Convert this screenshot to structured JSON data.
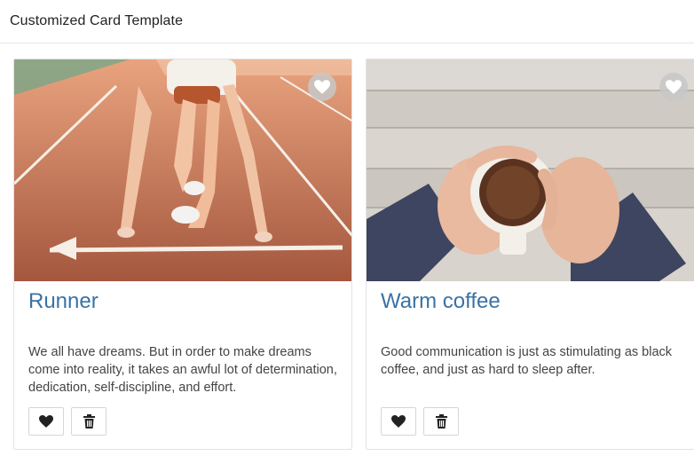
{
  "header": {
    "title": "Customized Card Template"
  },
  "cards": [
    {
      "title": "Runner",
      "text": "We all have dreams. But in order to make dreams come into reality, it takes an awful lot of determination, dedication, self-discipline, and effort.",
      "image_icon": "runner-photo",
      "badge_icon": "heart-icon",
      "actions": [
        {
          "icon": "heart-icon"
        },
        {
          "icon": "trash-icon"
        }
      ]
    },
    {
      "title": "Warm coffee",
      "text": "Good communication is just as stimulating as black coffee, and just as hard to sleep after.",
      "image_icon": "coffee-photo",
      "badge_icon": "heart-icon",
      "actions": [
        {
          "icon": "heart-icon"
        },
        {
          "icon": "trash-icon"
        }
      ]
    }
  ],
  "colors": {
    "title": "#3a72a4",
    "badge_bg": "#c8c8c8",
    "border": "#e3e3e3"
  }
}
